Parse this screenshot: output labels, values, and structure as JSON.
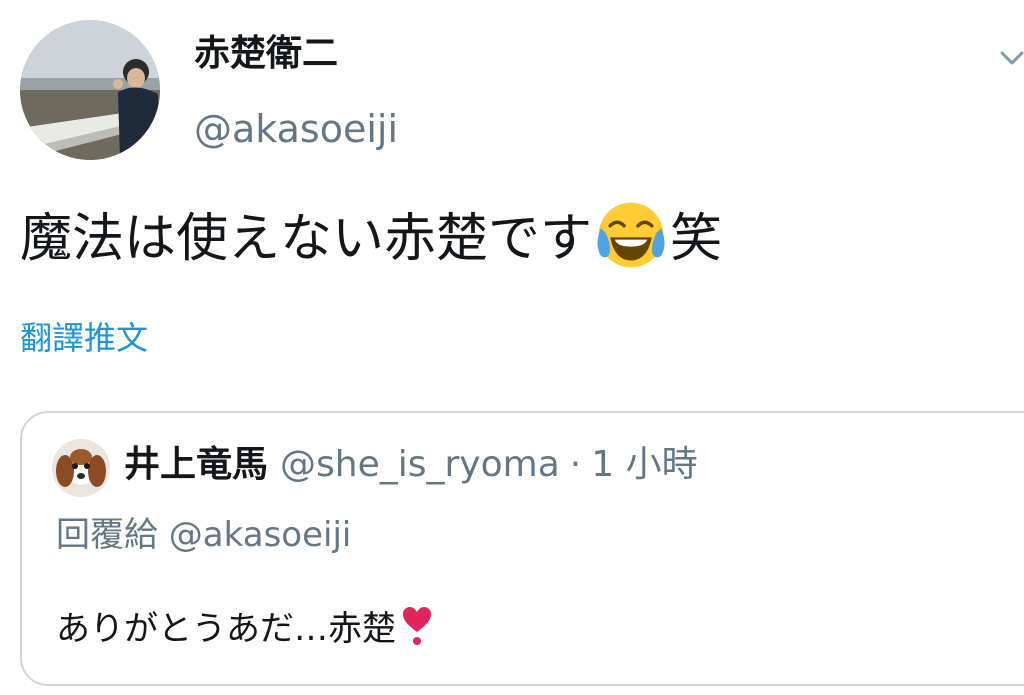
{
  "author": {
    "display_name": "赤楚衛二",
    "handle": "@akasoeiji"
  },
  "tweet": {
    "text_before_emoji": "魔法は使えない赤楚です",
    "emoji": "face-with-tears-of-joy-icon",
    "text_after_emoji": "笑",
    "translate_label": "翻譯推文"
  },
  "quoted_tweet": {
    "display_name": "井上竜馬",
    "handle": "@she_is_ryoma",
    "separator": "·",
    "time": "1 小時",
    "reply_to": "回覆給 @akasoeiji",
    "text": "ありがとうあだ…赤楚",
    "emoji": "heart-exclamation-icon"
  },
  "colors": {
    "link": "#1b95e0",
    "secondary_text": "#657786",
    "border": "#ccd6dd",
    "heart": "#e0245e"
  }
}
